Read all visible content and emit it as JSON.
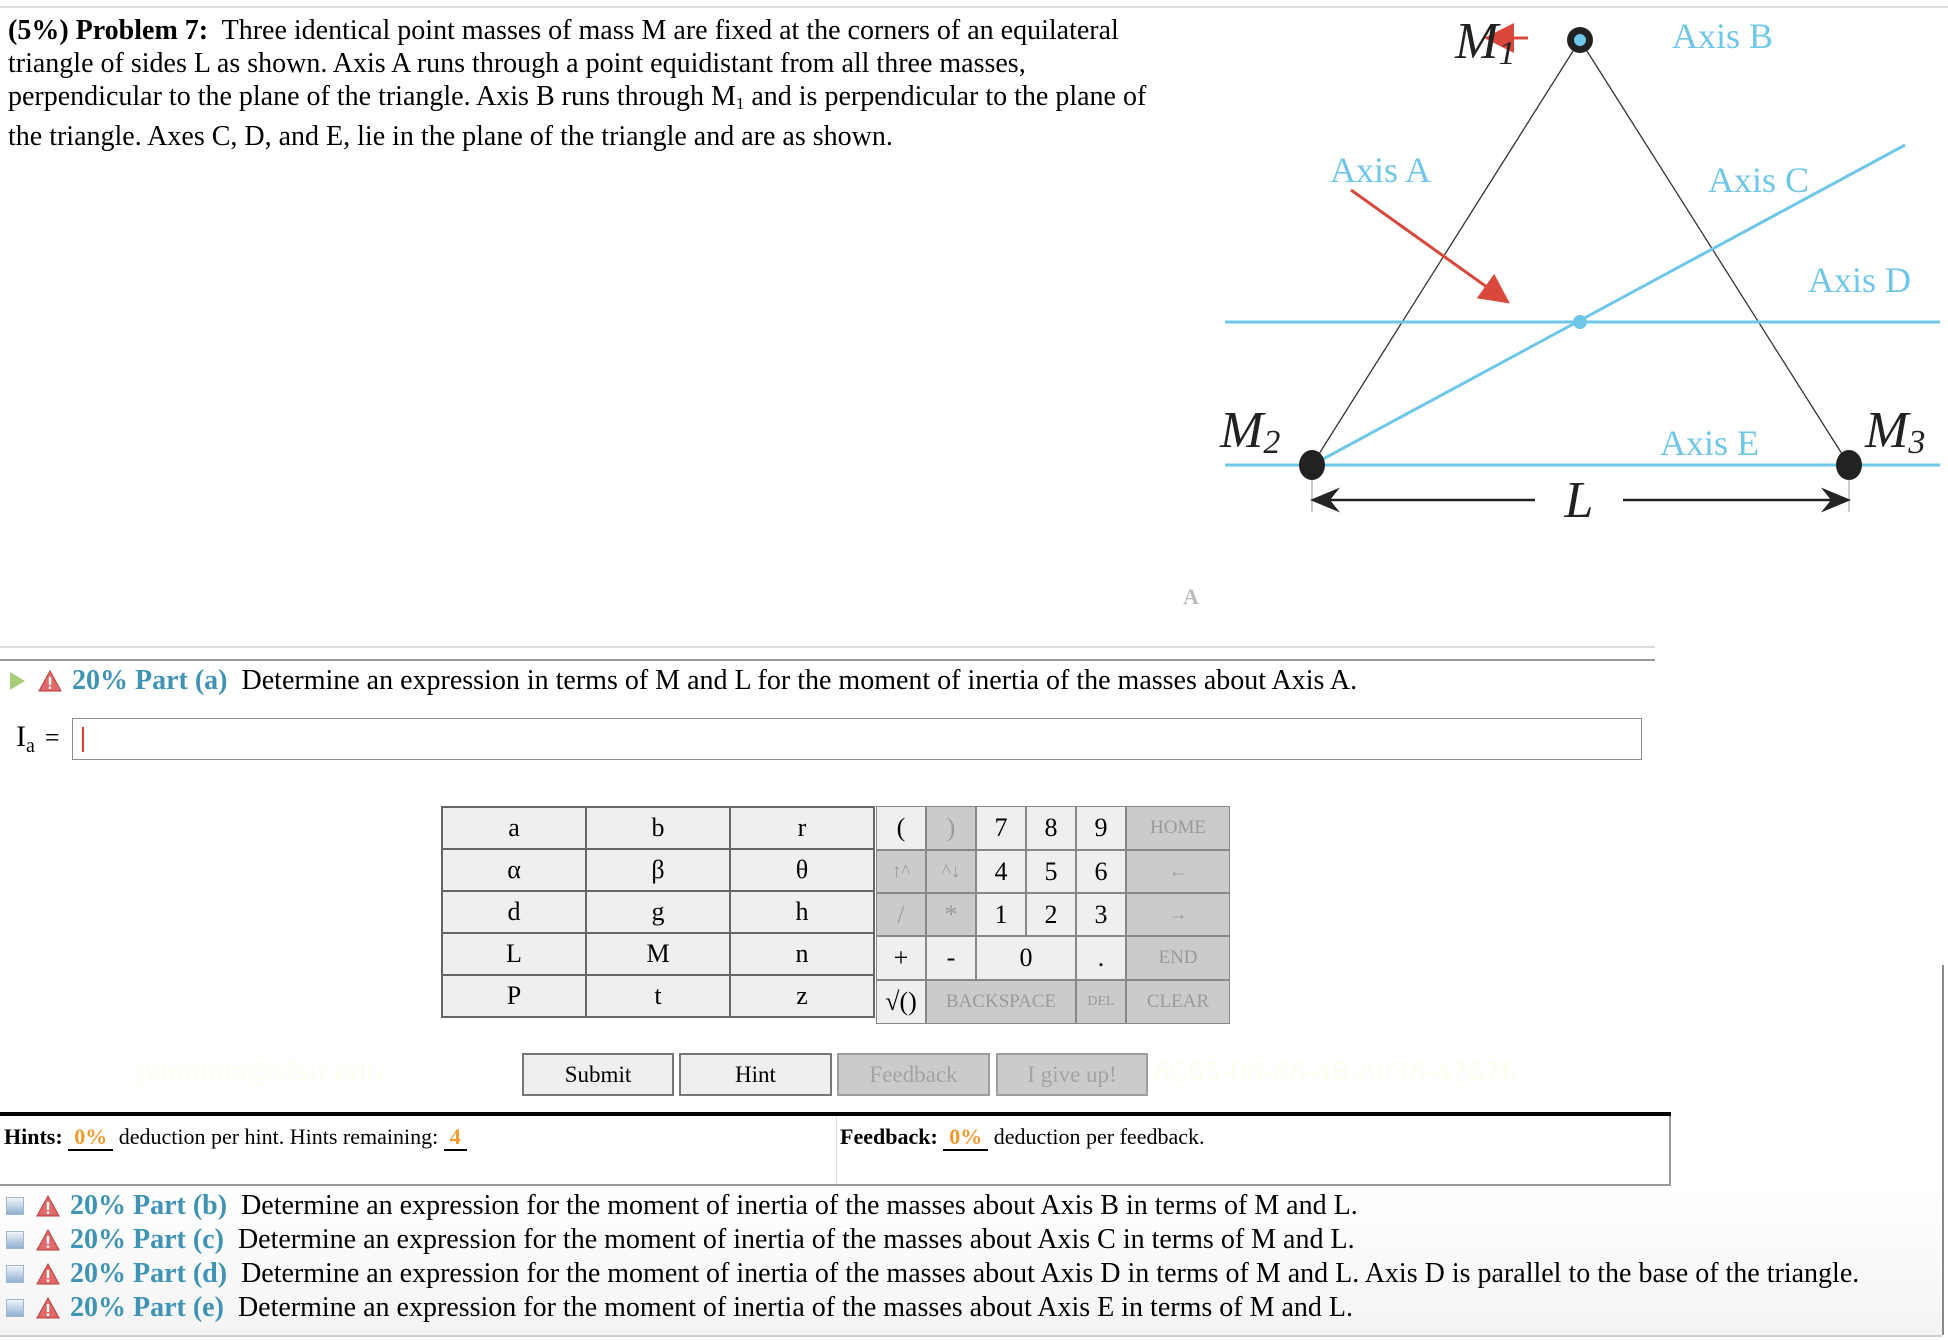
{
  "problem": {
    "weight": "(5%)",
    "title": "Problem 7:",
    "text_1": "Three identical point masses of mass M are fixed at the corners of an equilateral",
    "text_2": "triangle of sides L as shown. Axis A runs through a point equidistant from all three masses,",
    "text_3a": "perpendicular to the plane of the triangle. Axis B runs through M",
    "text_3sub": "1",
    "text_3b": " and is perpendicular to the plane of",
    "text_4": "the triangle. Axes C, D, and E, lie in the plane of the triangle and are as shown."
  },
  "diagram": {
    "masses": [
      {
        "label": "M",
        "sub": "1"
      },
      {
        "label": "M",
        "sub": "2"
      },
      {
        "label": "M",
        "sub": "3"
      }
    ],
    "axes": [
      "Axis A",
      "Axis B",
      "Axis C",
      "Axis D",
      "Axis E"
    ],
    "side_label": "L",
    "axis_color": "#6ec6e8",
    "arrow_color": "#d9483b",
    "stray_mark": "A"
  },
  "part_a": {
    "weight": "20%",
    "label": "Part (a)",
    "prompt": "Determine an expression in terms of M and L for the moment of inertia of the masses about Axis A.",
    "answer_label": "I",
    "answer_sub": "a",
    "answer_eq": "=",
    "answer_value": ""
  },
  "keypad": {
    "letters": [
      [
        "a",
        "b",
        "r"
      ],
      [
        "α",
        "β",
        "θ"
      ],
      [
        "d",
        "g",
        "h"
      ],
      [
        "L",
        "M",
        "n"
      ],
      [
        "P",
        "t",
        "z"
      ]
    ],
    "open_paren": "(",
    "close_paren": ")",
    "up_caret": "↑^",
    "down_caret": "^↓",
    "divide": "/",
    "multiply": "*",
    "plus": "+",
    "minus": "-",
    "sqrt": "√()",
    "digits": [
      "7",
      "8",
      "9",
      "4",
      "5",
      "6",
      "1",
      "2",
      "3",
      "0"
    ],
    "dot": ".",
    "home": "HOME",
    "left": "←",
    "right": "→",
    "end": "END",
    "backspace": "BACKSPACE",
    "del": "DEL",
    "clear": "CLEAR"
  },
  "buttons": {
    "submit": "Submit",
    "hint": "Hint",
    "feedback": "Feedback",
    "give_up": "I give up!"
  },
  "watermarks": {
    "email": "jvindiola@sfsu.edu",
    "code": "6C65-06-88-4B-A038-42676"
  },
  "hints": {
    "label": "Hints:",
    "deduction": "0%",
    "text": "deduction per hint. Hints remaining:",
    "remaining": "4"
  },
  "feedback": {
    "label": "Feedback:",
    "deduction": "0%",
    "text": "deduction per feedback."
  },
  "other_parts": [
    {
      "weight": "20%",
      "label": "Part (b)",
      "prompt": "Determine an expression for the moment of inertia of the masses about Axis B in terms of M and L."
    },
    {
      "weight": "20%",
      "label": "Part (c)",
      "prompt": "Determine an expression for the moment of inertia of the masses about Axis C in terms of M and L."
    },
    {
      "weight": "20%",
      "label": "Part (d)",
      "prompt": "Determine an expression for the moment of inertia of the masses about Axis D in terms of M and L. Axis D is parallel to the base of the triangle."
    },
    {
      "weight": "20%",
      "label": "Part (e)",
      "prompt": "Determine an expression for the moment of inertia of the masses about Axis E in terms of M and L."
    }
  ]
}
